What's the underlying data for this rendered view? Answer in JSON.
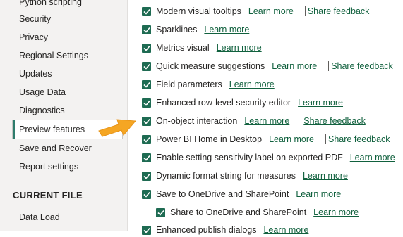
{
  "sidebar": {
    "items": [
      {
        "label": "Python scripting",
        "selected": false
      },
      {
        "label": "Security",
        "selected": false
      },
      {
        "label": "Privacy",
        "selected": false
      },
      {
        "label": "Regional Settings",
        "selected": false
      },
      {
        "label": "Updates",
        "selected": false
      },
      {
        "label": "Usage Data",
        "selected": false
      },
      {
        "label": "Diagnostics",
        "selected": false
      },
      {
        "label": "Preview features",
        "selected": true
      },
      {
        "label": "Save and Recover",
        "selected": false
      },
      {
        "label": "Report settings",
        "selected": false
      }
    ],
    "section_header": "CURRENT FILE",
    "current_file_items": [
      {
        "label": "Data Load"
      }
    ]
  },
  "features": [
    {
      "label": "Modern visual tooltips",
      "checked": true,
      "learn_more": "Learn more",
      "share_feedback": "Share feedback"
    },
    {
      "label": "Sparklines",
      "checked": true,
      "learn_more": "Learn more"
    },
    {
      "label": "Metrics visual",
      "checked": true,
      "learn_more": "Learn more"
    },
    {
      "label": "Quick measure suggestions",
      "checked": true,
      "learn_more": "Learn more",
      "share_feedback": "Share feedback"
    },
    {
      "label": "Field parameters",
      "checked": true,
      "learn_more": "Learn more"
    },
    {
      "label": "Enhanced row-level security editor",
      "checked": true,
      "learn_more": "Learn more"
    },
    {
      "label": "On-object interaction",
      "checked": true,
      "learn_more": "Learn more",
      "share_feedback": "Share feedback"
    },
    {
      "label": "Power BI Home in Desktop",
      "checked": true,
      "learn_more": "Learn more",
      "share_feedback": "Share feedback"
    },
    {
      "label": "Enable setting sensitivity label on exported PDF",
      "checked": true,
      "learn_more": "Learn more"
    },
    {
      "label": "Dynamic format string for measures",
      "checked": true,
      "learn_more": "Learn more"
    },
    {
      "label": "Save to OneDrive and SharePoint",
      "checked": true,
      "learn_more": "Learn more"
    },
    {
      "label": "Share to OneDrive and SharePoint",
      "checked": true,
      "learn_more": "Learn more",
      "indent": true
    },
    {
      "label": "Enhanced publish dialogs",
      "checked": true,
      "learn_more": "Learn more"
    }
  ],
  "colors": {
    "accent": "#1e6b52",
    "link": "#11613e",
    "arrow": "#f5a623",
    "sidebar_bg": "#f3f2f1"
  }
}
